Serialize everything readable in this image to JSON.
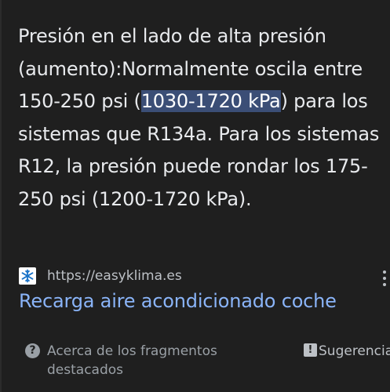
{
  "snippet": {
    "text_before": "Presión en el lado de alta presión (aumento):Normalmente oscila entre 150-250 psi (",
    "highlight": "1030-1720 kPa",
    "text_after": ") para los sistemas que R134a. Para los sistemas R12, la presión puede rondar los 175-250 psi (1200-1720 kPa)."
  },
  "source": {
    "favicon_icon": "snowflake-icon",
    "url": "https://easyklima.es"
  },
  "result": {
    "title": "Recarga aire acondicionado coche"
  },
  "footer": {
    "about_icon": "help-circle-icon",
    "about_label": "Acerca de los fragmentos destacados",
    "feedback_icon": "feedback-icon",
    "feedback_label": "Sugerencia"
  },
  "colors": {
    "background": "#1f1f1f",
    "text": "#e8eaed",
    "highlight_bg": "#3b4e76",
    "link": "#8ab4f8",
    "muted": "#9aa0a6"
  }
}
